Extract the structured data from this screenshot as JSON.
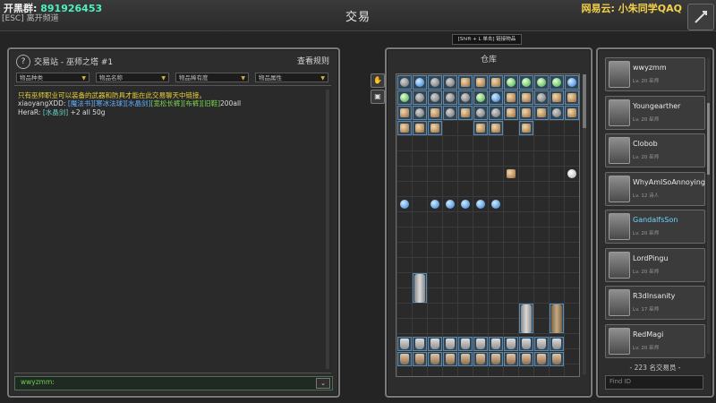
{
  "topbar": {
    "group_label": "开黑群:",
    "group_number": "891926453",
    "esc_label": "[ESC] 离开频道",
    "title": "交易",
    "watermark": "网易云: 小朱同学QAQ"
  },
  "left": {
    "badge": "?",
    "title": "交易站 - 巫师之塔 #1",
    "rules_button": "查看规则",
    "filters": [
      "物品种类",
      "物品名称",
      "物品稀有度",
      "物品属性"
    ],
    "messages": {
      "m0": "只有巫师职业可以装备的武器和防具才能在此交易聊天中链接。",
      "m1_user": "xiaoyangXDD:",
      "m1_t1": "[魔法书]",
      "m1_t2": "[寒冰法球]",
      "m1_t3": "[水晶剑]",
      "m1_t4": "[宽松长裤]",
      "m1_t5": "[布裤]",
      "m1_t6": "[旧鞋]",
      "m1_end": "200all",
      "m2_user": "HeraR:",
      "m2_t1": "[水晶剑]",
      "m2_end": "+2 all 50g"
    },
    "chat_input": "wwyzmm:",
    "send_icon": "chevron-down-icon"
  },
  "tools": [
    "hand-icon",
    "box-icon"
  ],
  "mid": {
    "hint": "[Shift + L 单击] 链接物品",
    "title": "仓库",
    "stack_labels": [
      "2",
      "3",
      "15",
      "2",
      "5"
    ]
  },
  "right": {
    "players": [
      {
        "name": "wwyzmm",
        "level": "Lv. 20 巫师",
        "highlight": false
      },
      {
        "name": "Youngearther",
        "level": "Lv. 20 巫师",
        "highlight": false
      },
      {
        "name": "Clobob",
        "level": "Lv. 20 巫师",
        "highlight": false
      },
      {
        "name": "WhyAmISoAnnoying",
        "level": "Lv. 12 诗人",
        "highlight": false
      },
      {
        "name": "GandalfsSon",
        "level": "Lv. 20 巫师",
        "highlight": true
      },
      {
        "name": "LordPingu",
        "level": "Lv. 20 巫师",
        "highlight": false
      },
      {
        "name": "R3dInsanity",
        "level": "Lv. 17 巫师",
        "highlight": false
      },
      {
        "name": "RedMagi",
        "level": "Lv. 20 巫师",
        "highlight": false
      }
    ],
    "traders": "- 223 名交易员 -",
    "find_placeholder": "Find ID"
  },
  "colors": {
    "accent_gold": "#e7d33a",
    "link_blue": "#61b0ff",
    "link_green": "#7bd24e",
    "highlight_name": "#6fd4ff"
  }
}
